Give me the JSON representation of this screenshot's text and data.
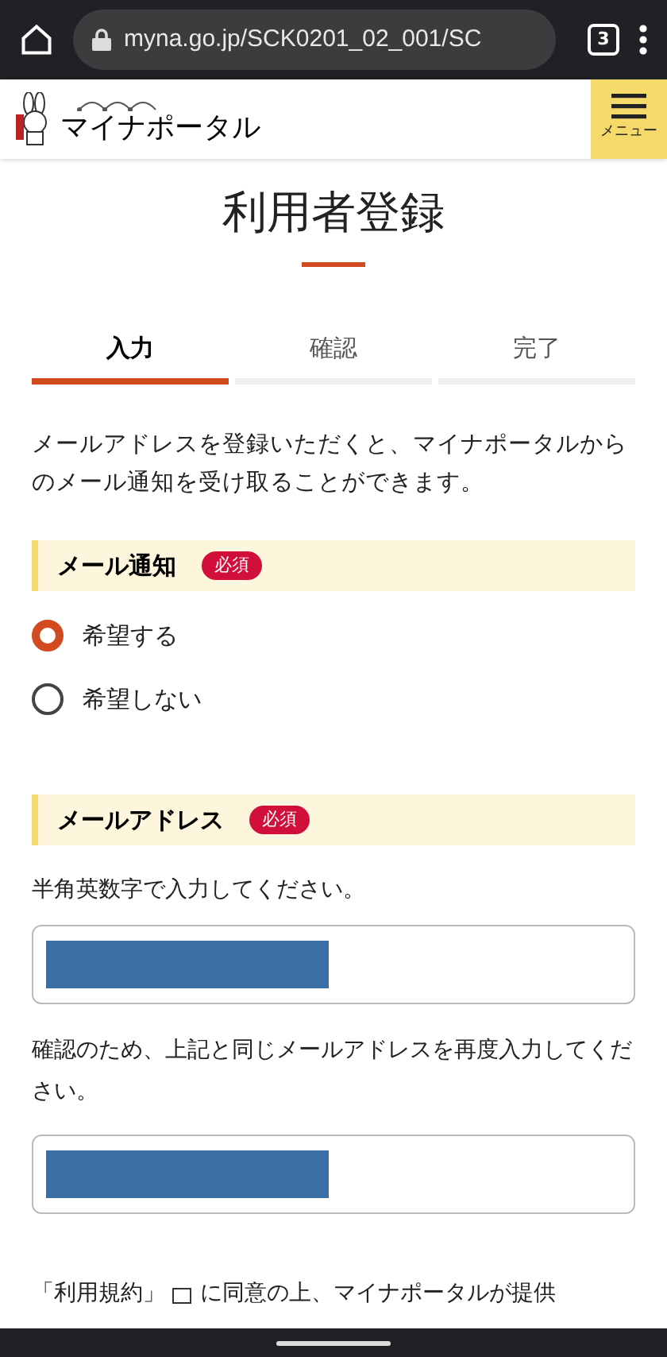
{
  "browser": {
    "url": "myna.go.jp/SCK0201_02_001/SC",
    "tab_count": "3"
  },
  "header": {
    "logo_text": "マイナポータル",
    "menu_label": "メニュー"
  },
  "title": "利用者登録",
  "steps": [
    {
      "label": "入力",
      "selected": true
    },
    {
      "label": "確認",
      "selected": false
    },
    {
      "label": "完了",
      "selected": false
    }
  ],
  "intro": "メールアドレスを登録いただくと、マイナポータルからのメール通知を受け取ることができます。",
  "notification": {
    "heading": "メール通知",
    "badge": "必須",
    "options": [
      {
        "label": "希望する",
        "selected": true
      },
      {
        "label": "希望しない",
        "selected": false
      }
    ]
  },
  "email": {
    "heading": "メールアドレス",
    "badge": "必須",
    "hint": "半角英数字で入力してください。",
    "confirm_hint": "確認のため、上記と同じメールアドレスを再度入力してください。"
  },
  "terms_text_start": "「利用規約」",
  "terms_text_end": "に同意の上、マイナポータルが提供"
}
